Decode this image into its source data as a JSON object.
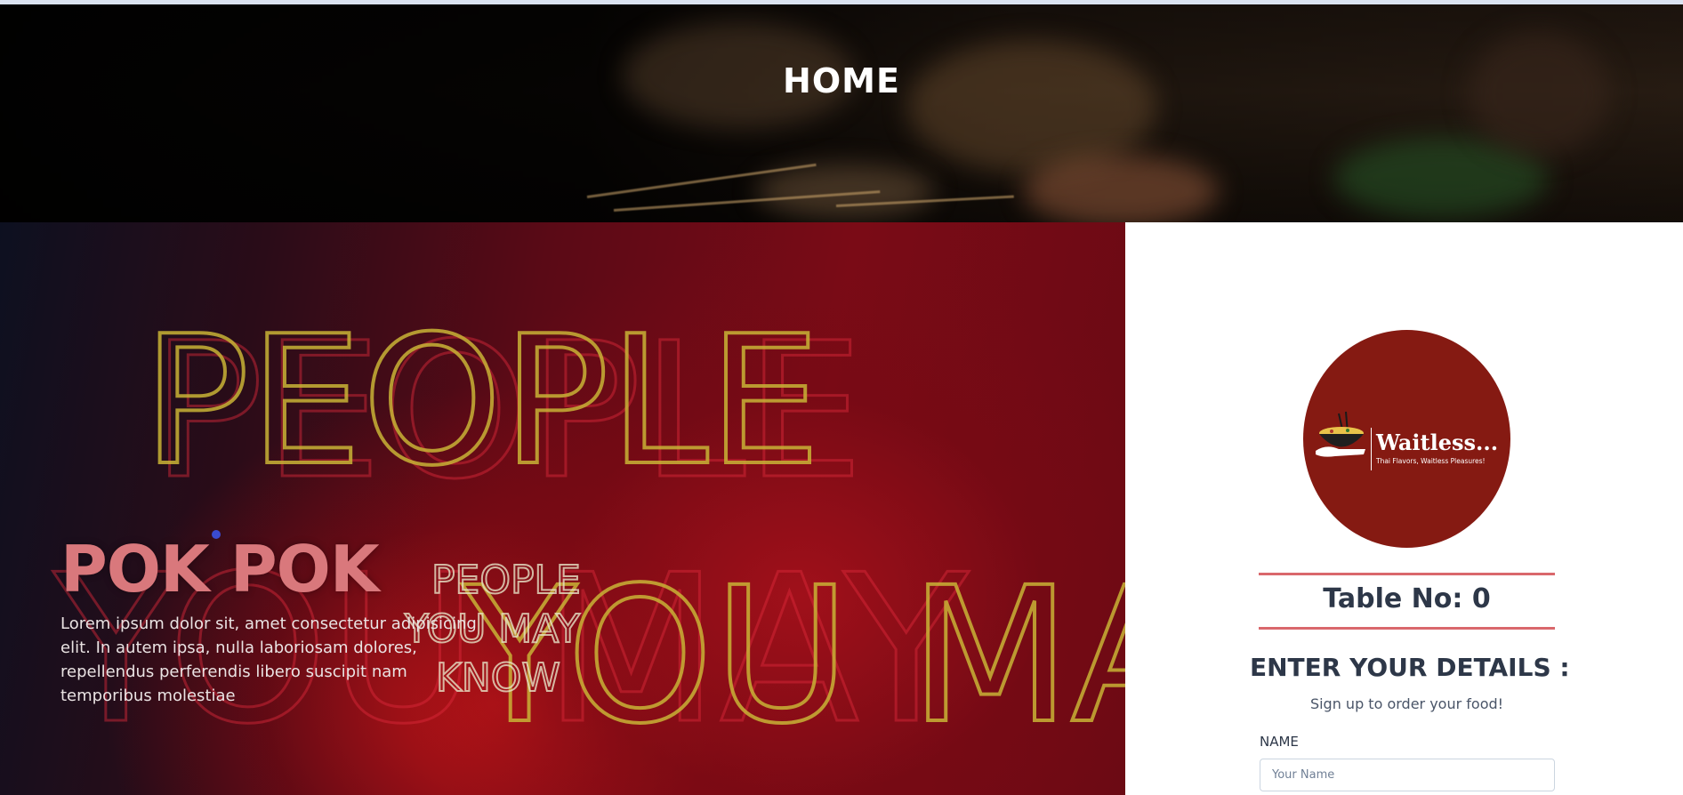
{
  "hero": {
    "title": "HOME"
  },
  "promo": {
    "title": "POK POK",
    "description": "Lorem ipsum dolor sit, amet consectetur adipisicing elit. In autem ipsa, nulla laboriosam dolores, repellendus perferendis libero suscipit nam temporibus molestiae",
    "neon_sign_large_line1": "PEOPLE",
    "neon_sign_large_line2": "YOU MAY",
    "neon_sign_small_line1": "PEOPLE",
    "neon_sign_small_line2": "YOU MAY",
    "neon_sign_small_line3": "KNOW"
  },
  "signup": {
    "logo": {
      "name": "Waitless...",
      "tagline": "Thai Flavors, Waitless Pleasures!"
    },
    "table_label": "Table No: 0",
    "heading": "ENTER YOUR DETAILS :",
    "subheading": "Sign up to order your food!",
    "name_label": "NAME",
    "name_placeholder": "Your Name",
    "name_value": ""
  },
  "colors": {
    "accent_rule": "#d9686c",
    "logo_background": "#851a12",
    "promo_title": "#d9787c",
    "heading_text": "#2d3748"
  }
}
